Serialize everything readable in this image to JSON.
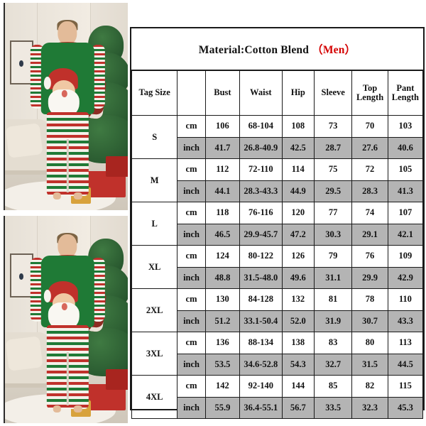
{
  "product_photo": {
    "alt": "man wearing green red white striped christmas santa pajama set beside christmas tree",
    "count": 2
  },
  "table": {
    "title_main": "Material:Cotton Blend",
    "title_paren": "（Men）",
    "title_paren_color": "#d40000",
    "headers": [
      "Tag Size",
      "",
      "Bust",
      "Waist",
      "Hip",
      "Sleeve",
      "Top Length",
      "Pant Length"
    ],
    "unit_labels": [
      "cm",
      "inch"
    ],
    "inch_row_background": "#b4b4b4",
    "rows": [
      {
        "size": "S",
        "cm": [
          "106",
          "68-104",
          "108",
          "73",
          "70",
          "103"
        ],
        "inch": [
          "41.7",
          "26.8-40.9",
          "42.5",
          "28.7",
          "27.6",
          "40.6"
        ]
      },
      {
        "size": "M",
        "cm": [
          "112",
          "72-110",
          "114",
          "75",
          "72",
          "105"
        ],
        "inch": [
          "44.1",
          "28.3-43.3",
          "44.9",
          "29.5",
          "28.3",
          "41.3"
        ]
      },
      {
        "size": "L",
        "cm": [
          "118",
          "76-116",
          "120",
          "77",
          "74",
          "107"
        ],
        "inch": [
          "46.5",
          "29.9-45.7",
          "47.2",
          "30.3",
          "29.1",
          "42.1"
        ]
      },
      {
        "size": "XL",
        "cm": [
          "124",
          "80-122",
          "126",
          "79",
          "76",
          "109"
        ],
        "inch": [
          "48.8",
          "31.5-48.0",
          "49.6",
          "31.1",
          "29.9",
          "42.9"
        ]
      },
      {
        "size": "2XL",
        "cm": [
          "130",
          "84-128",
          "132",
          "81",
          "78",
          "110"
        ],
        "inch": [
          "51.2",
          "33.1-50.4",
          "52.0",
          "31.9",
          "30.7",
          "43.3"
        ]
      },
      {
        "size": "3XL",
        "cm": [
          "136",
          "88-134",
          "138",
          "83",
          "80",
          "113"
        ],
        "inch": [
          "53.5",
          "34.6-52.8",
          "54.3",
          "32.7",
          "31.5",
          "44.5"
        ]
      },
      {
        "size": "4XL",
        "cm": [
          "142",
          "92-140",
          "144",
          "85",
          "82",
          "115"
        ],
        "inch": [
          "55.9",
          "36.4-55.1",
          "56.7",
          "33.5",
          "32.3",
          "45.3"
        ]
      }
    ]
  }
}
